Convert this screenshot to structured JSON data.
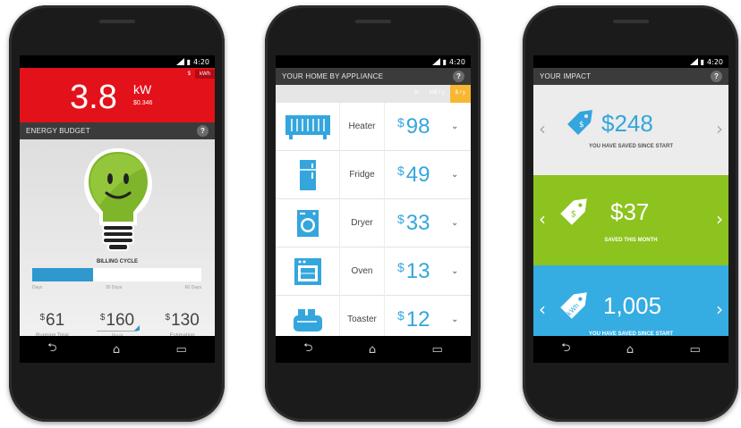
{
  "status": {
    "time": "4:20"
  },
  "phone1": {
    "unit_toggle": [
      "$",
      "kWh"
    ],
    "power_value": "3.8",
    "power_unit": "kW",
    "power_cost": "$0.346",
    "section_title": "ENERGY BUDGET",
    "help": "?",
    "billing_label": "BILLING CYCLE",
    "billing_progress": 0.36,
    "billing_ticks": [
      "Days",
      "30 Days",
      "60 Days"
    ],
    "stats": [
      {
        "currency": "$",
        "value": "61",
        "label": "Running Total"
      },
      {
        "currency": "$",
        "value": "160",
        "label": "Goal"
      },
      {
        "currency": "$",
        "value": "130",
        "label": "Estimation"
      }
    ]
  },
  "phone2": {
    "section_title": "YOUR HOME BY APPLIANCE",
    "help": "?",
    "tabs": [
      "%",
      "kW / y",
      "$ / y"
    ],
    "rows": [
      {
        "icon": "heater-icon",
        "name": "Heater",
        "currency": "$",
        "value": "98"
      },
      {
        "icon": "fridge-icon",
        "name": "Fridge",
        "currency": "$",
        "value": "49"
      },
      {
        "icon": "dryer-icon",
        "name": "Dryer",
        "currency": "$",
        "value": "33"
      },
      {
        "icon": "oven-icon",
        "name": "Oven",
        "currency": "$",
        "value": "13"
      },
      {
        "icon": "toaster-icon",
        "name": "Toaster",
        "currency": "$",
        "value": "12"
      }
    ]
  },
  "phone3": {
    "section_title": "YOUR IMPACT",
    "help": "?",
    "panels": [
      {
        "value": "$248",
        "caption": "YOU HAVE SAVED SINCE START",
        "tag": "$",
        "color": "#ececec"
      },
      {
        "value": "$37",
        "caption": "SAVED THIS MONTH",
        "tag": "$",
        "color": "#8cc31f"
      },
      {
        "value": "1,005",
        "caption": "YOU HAVE SAVED SINCE START",
        "tag": "kWh",
        "color": "#35ace2"
      }
    ]
  },
  "colors": {
    "accent_red": "#e3111a",
    "accent_blue": "#34a6dd",
    "accent_green": "#8cc31f",
    "accent_orange": "#f7b731"
  }
}
